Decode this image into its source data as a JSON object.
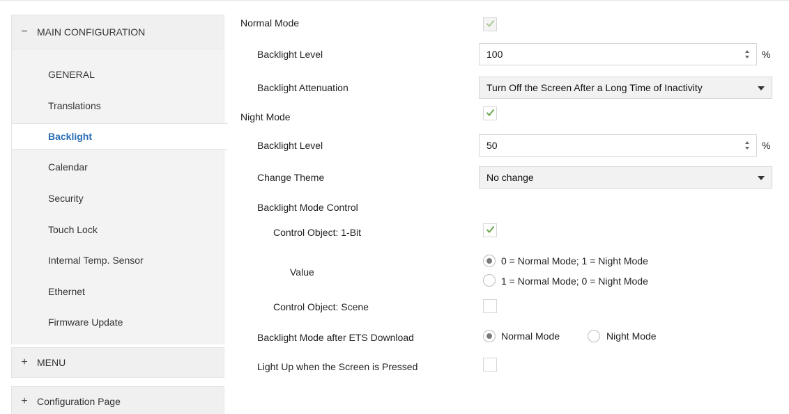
{
  "sidebar": {
    "main_group": {
      "sign": "−",
      "label": "MAIN CONFIGURATION"
    },
    "items": [
      {
        "label": "GENERAL"
      },
      {
        "label": "Translations"
      },
      {
        "label": "Backlight"
      },
      {
        "label": "Calendar"
      },
      {
        "label": "Security"
      },
      {
        "label": "Touch Lock"
      },
      {
        "label": "Internal Temp. Sensor"
      },
      {
        "label": "Ethernet"
      },
      {
        "label": "Firmware Update"
      }
    ],
    "active_item": "Backlight",
    "menu_group": {
      "sign": "+",
      "label": "MENU"
    },
    "config_group": {
      "sign": "+",
      "label": "Configuration Page"
    }
  },
  "main": {
    "normal_mode": {
      "label": "Normal Mode",
      "checked": true,
      "enabled": false
    },
    "normal_backlight_level": {
      "label": "Backlight Level",
      "value": "100",
      "unit": "%"
    },
    "normal_attenuation": {
      "label": "Backlight Attenuation",
      "value": "Turn Off the Screen After a Long Time of Inactivity"
    },
    "night_mode": {
      "label": "Night Mode",
      "checked": true
    },
    "night_backlight_level": {
      "label": "Backlight Level",
      "value": "50",
      "unit": "%"
    },
    "change_theme": {
      "label": "Change Theme",
      "value": "No change"
    },
    "mode_control": {
      "label": "Backlight Mode Control"
    },
    "control_1bit": {
      "label": "Control Object: 1-Bit",
      "checked": true
    },
    "value": {
      "label": "Value",
      "options": [
        "0 = Normal Mode; 1 = Night Mode",
        "1 = Normal Mode; 0 = Night Mode"
      ],
      "selected": 0
    },
    "control_scene": {
      "label": "Control Object: Scene",
      "checked": false
    },
    "after_download": {
      "label": "Backlight Mode after ETS Download",
      "options": [
        "Normal Mode",
        "Night Mode"
      ],
      "selected": 0
    },
    "light_up": {
      "label": "Light Up when the Screen is Pressed",
      "checked": false
    }
  },
  "colors": {
    "active_nav": "#2a6fb7",
    "check": "#6aa84f"
  }
}
